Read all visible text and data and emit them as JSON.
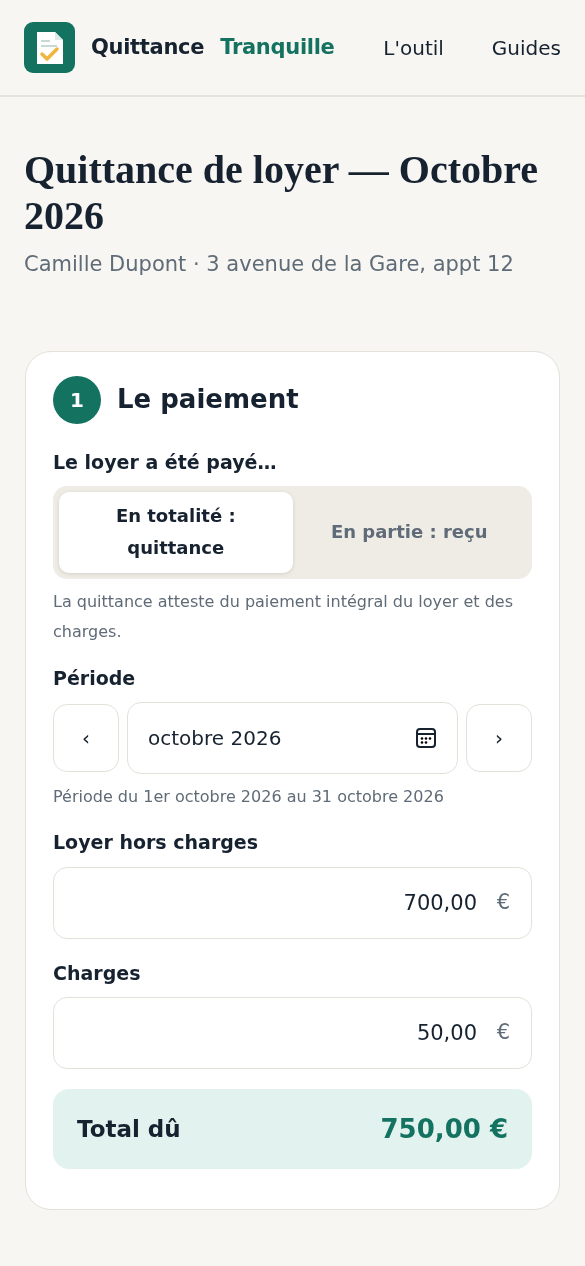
{
  "header": {
    "brand_first": "Quittance",
    "brand_second": "Tranquille",
    "nav": [
      {
        "label": "L'outil"
      },
      {
        "label": "Guides"
      }
    ]
  },
  "page": {
    "title": "Quittance de loyer — Octobre 2026",
    "subtitle": "Camille Dupont · 3 avenue de la Gare, appt 12"
  },
  "section": {
    "number": "1",
    "title": "Le paiement",
    "payment_label": "Le loyer a été payé…",
    "payment_options": [
      {
        "label": "En totalité : quittance",
        "selected": true
      },
      {
        "label": "En partie : reçu",
        "selected": false
      }
    ],
    "payment_help": "La quittance atteste du paiement intégral du loyer et des charges.",
    "period_label": "Période",
    "prev": "‹",
    "period_value": "octobre  2026",
    "next": "›",
    "period_help": "Période du 1er octobre 2026 au 31 octobre 2026",
    "amounts": [
      {
        "label": "Loyer hors charges",
        "value": "700,00",
        "unit": "€"
      },
      {
        "label": "Charges",
        "value": "50,00",
        "unit": "€"
      }
    ],
    "total_label": "Total dû",
    "total_value": "750,00 €"
  }
}
